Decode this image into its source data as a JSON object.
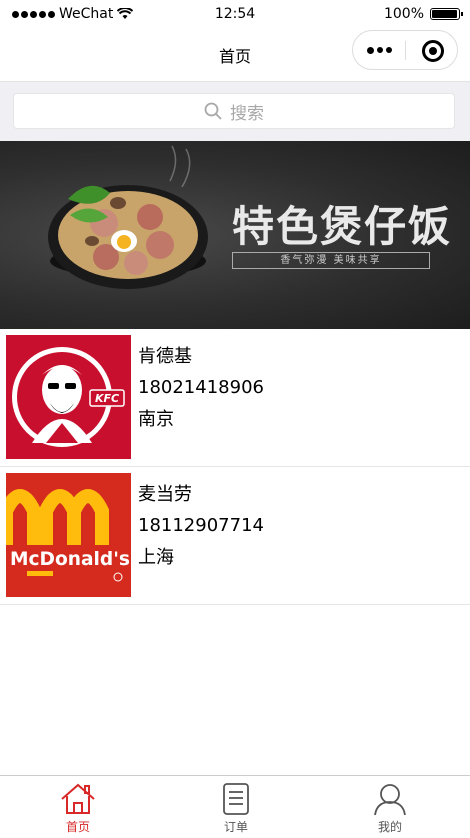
{
  "status_bar": {
    "carrier": "WeChat",
    "time": "12:54",
    "battery": "100%"
  },
  "navbar": {
    "title": "首页"
  },
  "search": {
    "placeholder": "搜索"
  },
  "banner": {
    "title": "特色煲仔饭",
    "subtitle": "香气弥漫 美味共享"
  },
  "stores": [
    {
      "name": "肯德基",
      "phone": "18021418906",
      "city": "南京",
      "logo": "kfc-logo"
    },
    {
      "name": "麦当劳",
      "phone": "18112907714",
      "city": "上海",
      "logo": "mcdonalds-logo",
      "logo_text": "McDonald's"
    }
  ],
  "tabbar": {
    "items": [
      {
        "label": "首页",
        "icon": "home-icon",
        "active": true
      },
      {
        "label": "订单",
        "icon": "order-icon",
        "active": false
      },
      {
        "label": "我的",
        "icon": "user-icon",
        "active": false
      }
    ]
  },
  "colors": {
    "accent": "#d8292a",
    "kfc_red": "#c8102e",
    "mcd_red": "#d52b1e",
    "mcd_yellow": "#ffbc0d"
  }
}
